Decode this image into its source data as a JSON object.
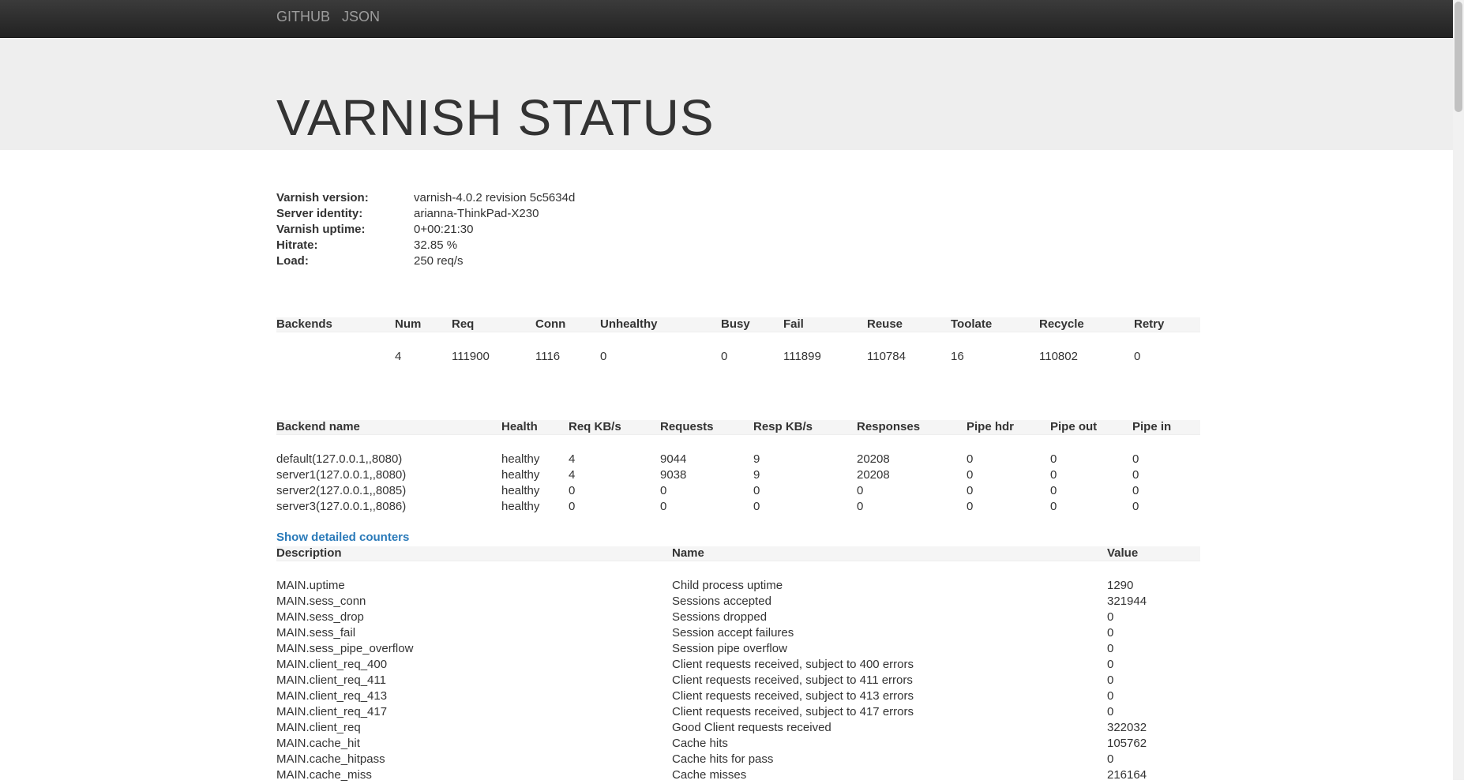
{
  "nav": {
    "github": "GITHUB",
    "json": "JSON"
  },
  "page_title": "VARNISH STATUS",
  "info": [
    {
      "label": "Varnish version:",
      "value": "varnish-4.0.2 revision 5c5634d"
    },
    {
      "label": "Server identity:",
      "value": "arianna-ThinkPad-X230"
    },
    {
      "label": "Varnish uptime:",
      "value": "0+00:21:30"
    },
    {
      "label": "Hitrate:",
      "value": "32.85 %"
    },
    {
      "label": "Load:",
      "value": "250 req/s"
    }
  ],
  "backends_summary": {
    "headers": [
      "Backends",
      "Num",
      "Req",
      "Conn",
      "Unhealthy",
      "Busy",
      "Fail",
      "Reuse",
      "Toolate",
      "Recycle",
      "Retry"
    ],
    "row": [
      "",
      "4",
      "111900",
      "1116",
      "0",
      "0",
      "111899",
      "110784",
      "16",
      "110802",
      "0"
    ]
  },
  "backends": {
    "headers": [
      "Backend name",
      "Health",
      "Req KB/s",
      "Requests",
      "Resp KB/s",
      "Responses",
      "Pipe hdr",
      "Pipe out",
      "Pipe in"
    ],
    "rows": [
      [
        "default(127.0.0.1,,8080)",
        "healthy",
        "4",
        "9044",
        "9",
        "20208",
        "0",
        "0",
        "0"
      ],
      [
        "server1(127.0.0.1,,8080)",
        "healthy",
        "4",
        "9038",
        "9",
        "20208",
        "0",
        "0",
        "0"
      ],
      [
        "server2(127.0.0.1,,8085)",
        "healthy",
        "0",
        "0",
        "0",
        "0",
        "0",
        "0",
        "0"
      ],
      [
        "server3(127.0.0.1,,8086)",
        "healthy",
        "0",
        "0",
        "0",
        "0",
        "0",
        "0",
        "0"
      ]
    ]
  },
  "show_detailed": "Show detailed counters",
  "counters": {
    "headers": [
      "Description",
      "Name",
      "Value"
    ],
    "rows": [
      [
        "MAIN.uptime",
        "Child process uptime",
        "1290"
      ],
      [
        "MAIN.sess_conn",
        "Sessions accepted",
        "321944"
      ],
      [
        "MAIN.sess_drop",
        "Sessions dropped",
        "0"
      ],
      [
        "MAIN.sess_fail",
        "Session accept failures",
        "0"
      ],
      [
        "MAIN.sess_pipe_overflow",
        "Session pipe overflow",
        "0"
      ],
      [
        "MAIN.client_req_400",
        "Client requests received, subject to 400 errors",
        "0"
      ],
      [
        "MAIN.client_req_411",
        "Client requests received, subject to 411 errors",
        "0"
      ],
      [
        "MAIN.client_req_413",
        "Client requests received, subject to 413 errors",
        "0"
      ],
      [
        "MAIN.client_req_417",
        "Client requests received, subject to 417 errors",
        "0"
      ],
      [
        "MAIN.client_req",
        "Good Client requests received",
        "322032"
      ],
      [
        "MAIN.cache_hit",
        "Cache hits",
        "105762"
      ],
      [
        "MAIN.cache_hitpass",
        "Cache hits for pass",
        "0"
      ],
      [
        "MAIN.cache_miss",
        "Cache misses",
        "216164"
      ]
    ]
  }
}
